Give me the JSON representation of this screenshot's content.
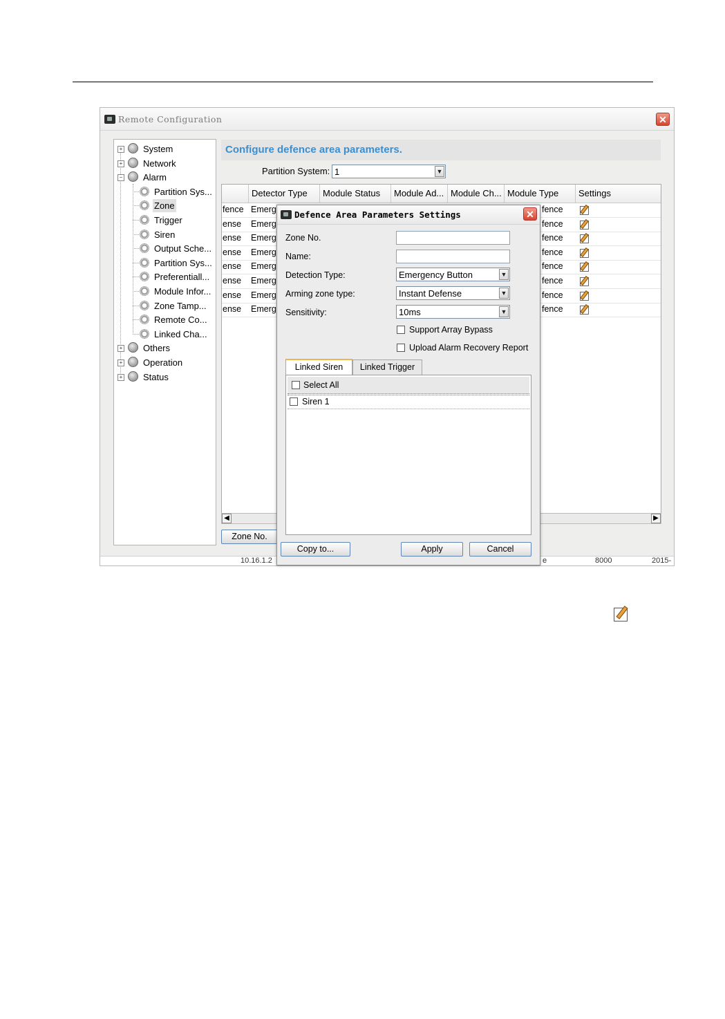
{
  "window": {
    "title": "Remote Configuration"
  },
  "tree": {
    "items": [
      {
        "label": "System",
        "kind": "root",
        "expander": "+"
      },
      {
        "label": "Network",
        "kind": "root",
        "expander": "+"
      },
      {
        "label": "Alarm",
        "kind": "root",
        "expander": "-"
      },
      {
        "label": "Partition Sys...",
        "kind": "child"
      },
      {
        "label": "Zone",
        "kind": "child",
        "selected": true
      },
      {
        "label": "Trigger",
        "kind": "child"
      },
      {
        "label": "Siren",
        "kind": "child"
      },
      {
        "label": "Output Sche...",
        "kind": "child"
      },
      {
        "label": "Partition Sys...",
        "kind": "child"
      },
      {
        "label": "Preferentiall...",
        "kind": "child"
      },
      {
        "label": "Module Infor...",
        "kind": "child"
      },
      {
        "label": "Zone Tamp...",
        "kind": "child"
      },
      {
        "label": "Remote Co...",
        "kind": "child"
      },
      {
        "label": "Linked Cha...",
        "kind": "child"
      },
      {
        "label": "Others",
        "kind": "root",
        "expander": "+"
      },
      {
        "label": "Operation",
        "kind": "root",
        "expander": "+"
      },
      {
        "label": "Status",
        "kind": "root",
        "expander": "+"
      }
    ]
  },
  "content": {
    "title": "Configure defence area parameters.",
    "partition_label": "Partition System:",
    "partition_value": "1"
  },
  "table": {
    "columns": [
      "Detector Type",
      "Module Status",
      "Module Ad...",
      "Module Ch...",
      "Module Type",
      "Settings"
    ],
    "rows": [
      {
        "left": "fence",
        "detector": "Emerg",
        "right": "fence"
      },
      {
        "left": "ense",
        "detector": "Emerg",
        "right": "fence"
      },
      {
        "left": "ense",
        "detector": "Emerg",
        "right": "fence"
      },
      {
        "left": "ense",
        "detector": "Emerg",
        "right": "fence"
      },
      {
        "left": "ense",
        "detector": "Emerg",
        "right": "fence"
      },
      {
        "left": "ense",
        "detector": "Emerg",
        "right": "fence"
      },
      {
        "left": "ense",
        "detector": "Emerg",
        "right": "fence"
      },
      {
        "left": "ense",
        "detector": "Emerg",
        "right": "fence"
      }
    ]
  },
  "zone_no_button": "Zone No.",
  "bottom_strip": {
    "ip": "10.16.1.2",
    "mid": "e",
    "port": "8000",
    "date": "2015-"
  },
  "dialog": {
    "title": "Defence Area Parameters Settings",
    "zone_no_label": "Zone No.",
    "zone_no_value": "",
    "name_label": "Name:",
    "name_value": "",
    "detection_type_label": "Detection Type:",
    "detection_type_value": "Emergency Button",
    "arming_label": "Arming zone type:",
    "arming_value": "Instant Defense",
    "sensitivity_label": "Sensitivity:",
    "sensitivity_value": "10ms",
    "support_bypass_label": "Support Array Bypass",
    "support_bypass_checked": false,
    "upload_recovery_label": "Upload Alarm Recovery Report",
    "upload_recovery_checked": false,
    "tabs": [
      "Linked Siren",
      "Linked Trigger"
    ],
    "active_tab": "Linked Siren",
    "select_all_label": "Select All",
    "sirens": [
      {
        "label": "Siren 1",
        "checked": false
      }
    ],
    "copy_label": "Copy to...",
    "apply_label": "Apply",
    "cancel_label": "Cancel"
  },
  "icons": {
    "close": "close-icon",
    "edit": "edit-icon",
    "app": "app-window-icon",
    "tree_root": "globe-icon",
    "tree_child": "gear-icon"
  },
  "colors": {
    "title_blue": "#3b8fd0",
    "close_red": "#d9452e",
    "tab_accent": "#f0b64a"
  }
}
